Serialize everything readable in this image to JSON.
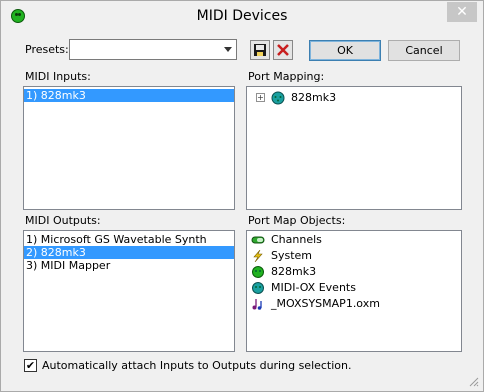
{
  "window": {
    "title": "MIDI Devices",
    "close_glyph": "✕"
  },
  "presets": {
    "label": "Presets:",
    "value": ""
  },
  "toolbar": {
    "save_icon": "floppy-disk-icon",
    "delete_icon": "red-x-icon",
    "ok_label": "OK",
    "cancel_label": "Cancel"
  },
  "midi_inputs": {
    "label": "MIDI Inputs:",
    "items": [
      {
        "text": "1)  828mk3",
        "selected": true
      }
    ]
  },
  "port_mapping": {
    "label": "Port Mapping:",
    "items": [
      {
        "text": "828mk3",
        "expander": "+",
        "icon": "midi-port-icon"
      }
    ]
  },
  "midi_outputs": {
    "label": "MIDI Outputs:",
    "items": [
      {
        "text": "1)  Microsoft GS Wavetable Synth",
        "selected": false
      },
      {
        "text": "2)  828mk3",
        "selected": true
      },
      {
        "text": "3)  MIDI Mapper",
        "selected": false
      }
    ]
  },
  "port_map_objects": {
    "label": "Port Map Objects:",
    "items": [
      {
        "text": "Channels",
        "icon": "channels-icon"
      },
      {
        "text": "System",
        "icon": "lightning-icon"
      },
      {
        "text": "828mk3",
        "icon": "midi-port-icon"
      },
      {
        "text": "MIDI-OX Events",
        "icon": "events-icon"
      },
      {
        "text": "_MOXSYSMAP1.oxm",
        "icon": "music-note-icon"
      }
    ]
  },
  "auto_attach": {
    "label": "Automatically attach Inputs to Outputs during selection.",
    "checked": true,
    "check_glyph": "✔"
  },
  "colors": {
    "selection": "#3399ff",
    "midi_green": "#21b221",
    "teal": "#1aa0a0"
  }
}
